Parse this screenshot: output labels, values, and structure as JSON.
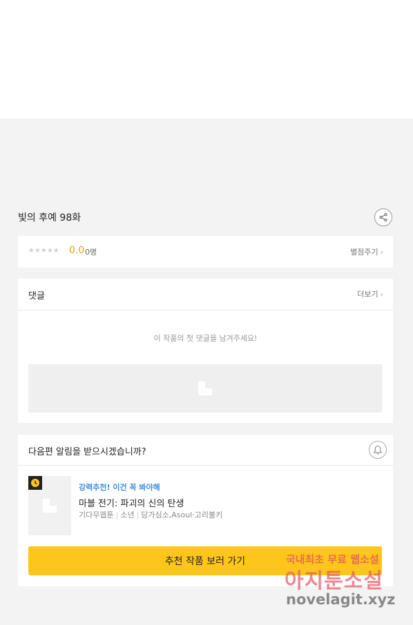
{
  "episode": {
    "title": "빛의 후예 98화"
  },
  "rating": {
    "stars": "★★★★★",
    "score": "0.0",
    "count": "0명",
    "rate_link": "별점주기"
  },
  "comments": {
    "title": "댓글",
    "more_link": "더보기",
    "empty_message": "이 작품의 첫 댓글을 남겨주세요!"
  },
  "notify": {
    "question": "다음편 알림을 받으시겠습니까?",
    "recommendation": {
      "promo": "강력추천! 이건 꼭 봐야해",
      "title": "마블 전기: 파괴의 신의 탄생",
      "meta": [
        "기다무웹툰",
        "소년",
        "당가심소,Asoul·고리불키"
      ]
    },
    "cta_label": "추천 작품 보러 가기"
  },
  "watermark": {
    "line1": "국내최초 무료 웹소설",
    "line2": "아지툰소설",
    "line3": "novelagit.xyz"
  },
  "icons": {
    "chevron": "›",
    "share": "share-icon",
    "bell": "bell-icon",
    "clock": "clock-icon"
  },
  "colors": {
    "accent": "#fec61a",
    "score": "#e8a100",
    "promo": "#3c8ee0"
  }
}
